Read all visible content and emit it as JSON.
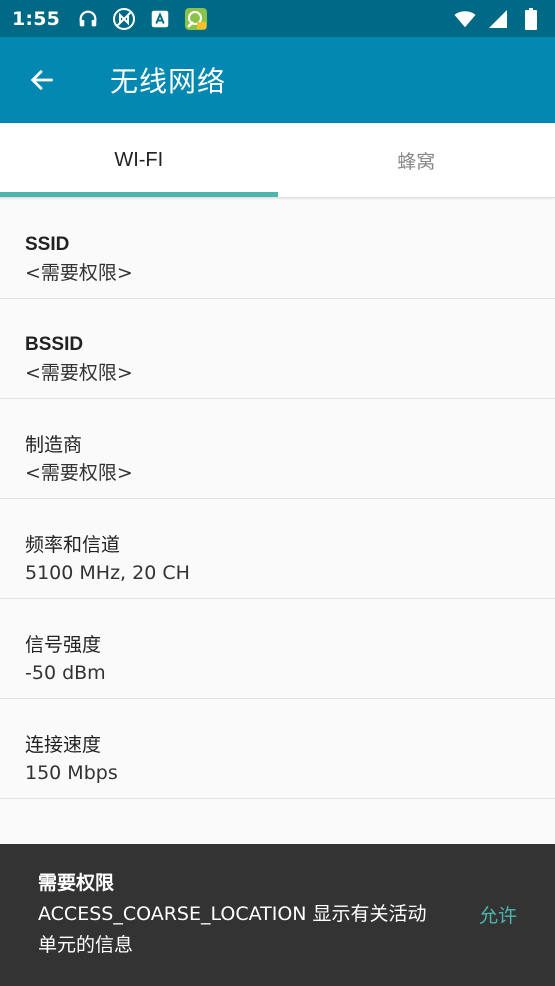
{
  "status_bar": {
    "time": "1:55",
    "icons": [
      "headset-icon",
      "nfc-off-icon",
      "font-app-icon",
      "map-app-icon",
      "wifi-icon",
      "signal-icon",
      "battery-icon"
    ]
  },
  "app_bar": {
    "back_icon": "arrow-back-icon",
    "title": "无线网络"
  },
  "tabs": [
    {
      "label": "WI-FI",
      "active": true
    },
    {
      "label": "蜂窝",
      "active": false
    }
  ],
  "rows": [
    {
      "label": "SSID",
      "value": "<需要权限>"
    },
    {
      "label": "BSSID",
      "value": "<需要权限>"
    },
    {
      "label": "制造商",
      "value": "<需要权限>"
    },
    {
      "label": "频率和信道",
      "value": "5100 MHz, 20 CH"
    },
    {
      "label": "信号强度",
      "value": "-50 dBm"
    },
    {
      "label": "连接速度",
      "value": "150 Mbps"
    }
  ],
  "snackbar": {
    "title": "需要权限",
    "message": "ACCESS_COARSE_LOCATION 显示有关活动单元的信息",
    "action": "允许"
  },
  "colors": {
    "status_bar": "#006a86",
    "app_bar": "#0288b1",
    "accent": "#4db6ac",
    "snackbar": "#333333"
  }
}
